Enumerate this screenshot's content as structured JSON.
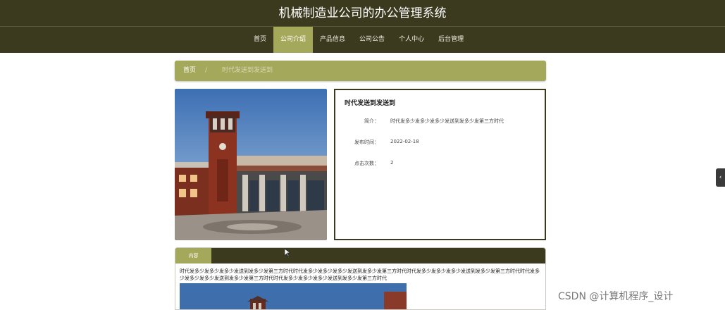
{
  "header": {
    "title": "机械制造业公司的办公管理系统"
  },
  "nav": {
    "items": [
      {
        "label": "首页"
      },
      {
        "label": "公司介绍"
      },
      {
        "label": "产品信息"
      },
      {
        "label": "公司公告"
      },
      {
        "label": "个人中心"
      },
      {
        "label": "后台管理"
      }
    ],
    "active_index": 1
  },
  "breadcrumb": {
    "home": "首页",
    "separator": "/",
    "current": "时代发送到发送到"
  },
  "detail": {
    "title": "时代发送到发送到",
    "fields": [
      {
        "label": "简介：",
        "value": "时代发多少发多少发多少发送到发多少发第三方时代"
      },
      {
        "label": "发布时间：",
        "value": "2022-02-18"
      },
      {
        "label": "点击次数：",
        "value": "2"
      }
    ]
  },
  "content_panel": {
    "tab_label": "内容",
    "text": "时代发多少发多少发多少发送到发多少发第三方时代时代发多少发多少发多少发送到发多少发第三方时代时代发多少发多少发多少发送到发多少发第三方时代时代发多少发多少发多少发送到发多少发第三方时代时代发多少发多少发多少发送到发多少发第三方时代"
  },
  "watermark": "CSDN @计算机程序_设计",
  "colors": {
    "dark_olive": "#3b3a1f",
    "accent_olive": "#a4a85a"
  },
  "icons": {
    "side_handle": "chevron-left-icon",
    "cursor": "mouse-pointer-icon"
  }
}
